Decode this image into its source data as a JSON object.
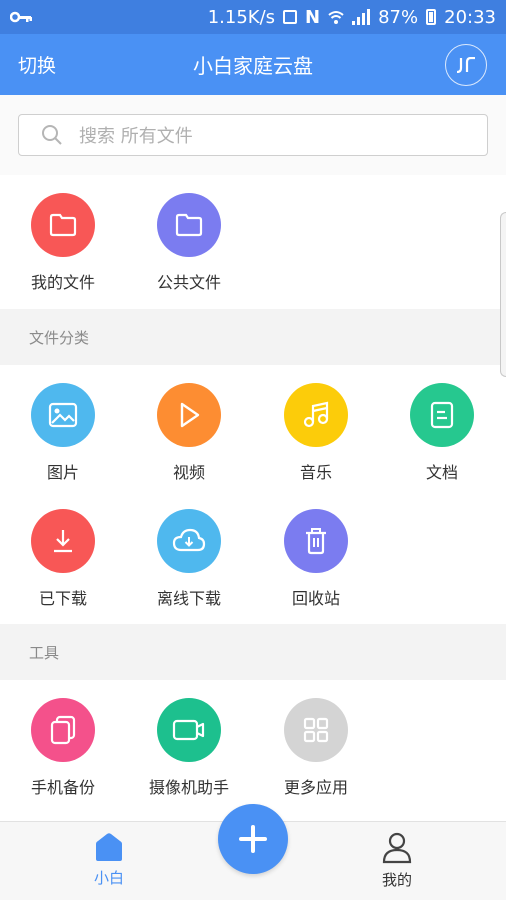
{
  "status_bar": {
    "speed": "1.15K/s",
    "battery": "87%",
    "time": "20:33"
  },
  "app_bar": {
    "switch_label": "切换",
    "title": "小白家庭云盘"
  },
  "search": {
    "placeholder": "搜索 所有文件"
  },
  "top_items": [
    {
      "label": "我的文件",
      "color": "#f85756",
      "icon": "folder-icon"
    },
    {
      "label": "公共文件",
      "color": "#7b7cf0",
      "icon": "folder-icon"
    }
  ],
  "categories": {
    "title": "文件分类",
    "items": [
      {
        "label": "图片",
        "color": "#4fb8ee",
        "icon": "image-icon"
      },
      {
        "label": "视频",
        "color": "#fd8d32",
        "icon": "play-icon"
      },
      {
        "label": "音乐",
        "color": "#fccc0a",
        "icon": "music-icon"
      },
      {
        "label": "文档",
        "color": "#26c88f",
        "icon": "document-icon"
      },
      {
        "label": "已下载",
        "color": "#f85756",
        "icon": "download-icon"
      },
      {
        "label": "离线下载",
        "color": "#4fb8ee",
        "icon": "cloud-download-icon"
      },
      {
        "label": "回收站",
        "color": "#7b7cf0",
        "icon": "trash-icon"
      }
    ]
  },
  "tools": {
    "title": "工具",
    "items": [
      {
        "label": "手机备份",
        "color": "#f4518b",
        "icon": "backup-icon"
      },
      {
        "label": "摄像机助手",
        "color": "#1dc08e",
        "icon": "camera-icon"
      },
      {
        "label": "更多应用",
        "color": "#d4d4d4",
        "icon": "grid-icon"
      }
    ]
  },
  "bottom_nav": {
    "home_label": "小白",
    "me_label": "我的",
    "active_color": "#4a91f4"
  }
}
